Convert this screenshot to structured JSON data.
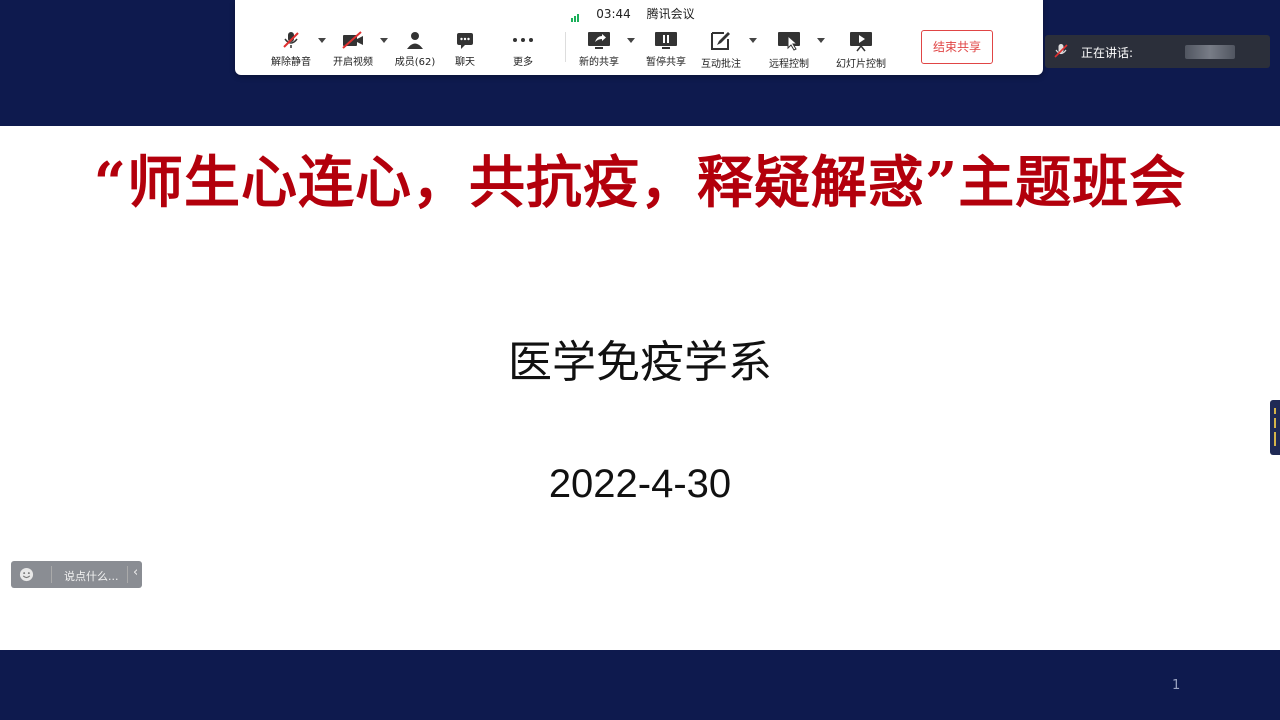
{
  "toolbar": {
    "time": "03:44",
    "app_name": "腾讯会议",
    "items": {
      "unmute": "解除静音",
      "start_video": "开启视频",
      "members": "成员(62)",
      "chat": "聊天",
      "more": "更多",
      "new_share": "新的共享",
      "pause_share": "暂停共享",
      "annotate": "互动批注",
      "remote_control": "远程控制",
      "slide_control": "幻灯片控制"
    },
    "end_share": "结束共享"
  },
  "speaking": {
    "label": "正在讲话:"
  },
  "slide": {
    "title": "“师生心连心，共抗疫，释疑解惑”主题班会",
    "subtitle": "医学免疫学系",
    "date": "2022-4-30",
    "page_number": "1"
  },
  "chat": {
    "placeholder": "说点什么..."
  },
  "colors": {
    "title_red": "#b3000c",
    "band_navy": "#0e1a4e",
    "end_share_red": "#e04545",
    "signal_green": "#1bb05a"
  }
}
